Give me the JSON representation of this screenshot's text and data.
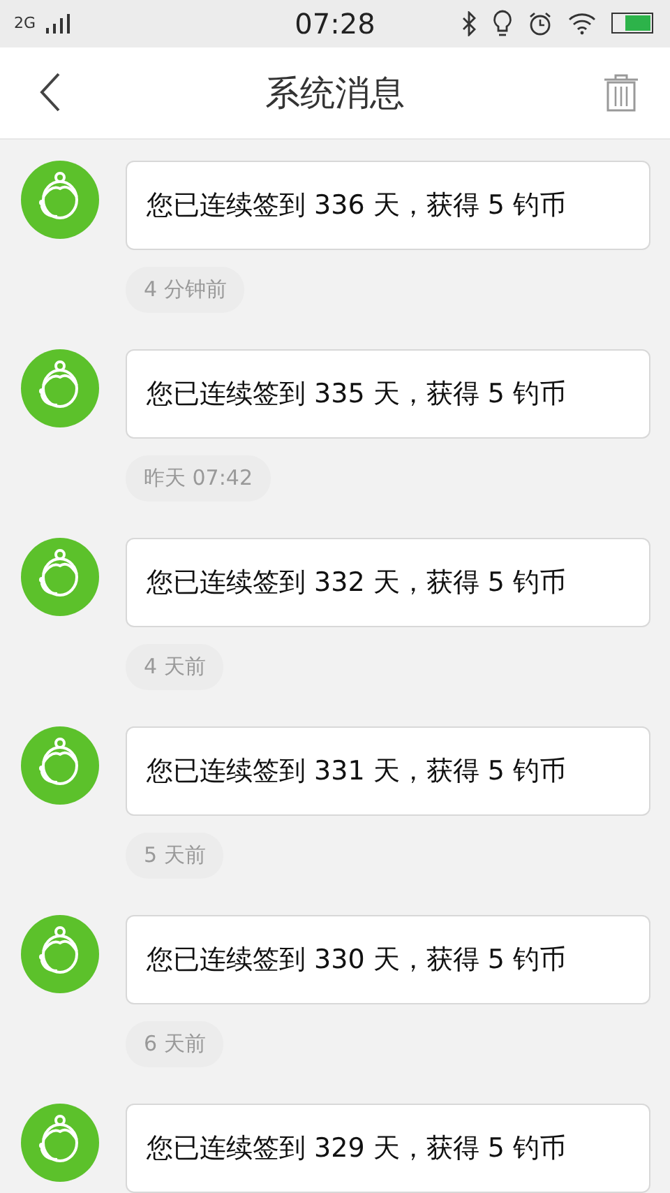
{
  "status_bar": {
    "network": "2G",
    "time": "07:28"
  },
  "header": {
    "title": "系统消息"
  },
  "messages": [
    {
      "text": "您已连续签到 336 天，获得 5 钓币",
      "time": "4 分钟前"
    },
    {
      "text": "您已连续签到 335 天，获得 5 钓币",
      "time": "昨天 07:42"
    },
    {
      "text": "您已连续签到 332 天，获得 5 钓币",
      "time": "4 天前"
    },
    {
      "text": "您已连续签到 331 天，获得 5 钓币",
      "time": "5 天前"
    },
    {
      "text": "您已连续签到 330 天，获得 5 钓币",
      "time": "6 天前"
    },
    {
      "text": "您已连续签到 329 天，获得 5 钓币"
    }
  ]
}
